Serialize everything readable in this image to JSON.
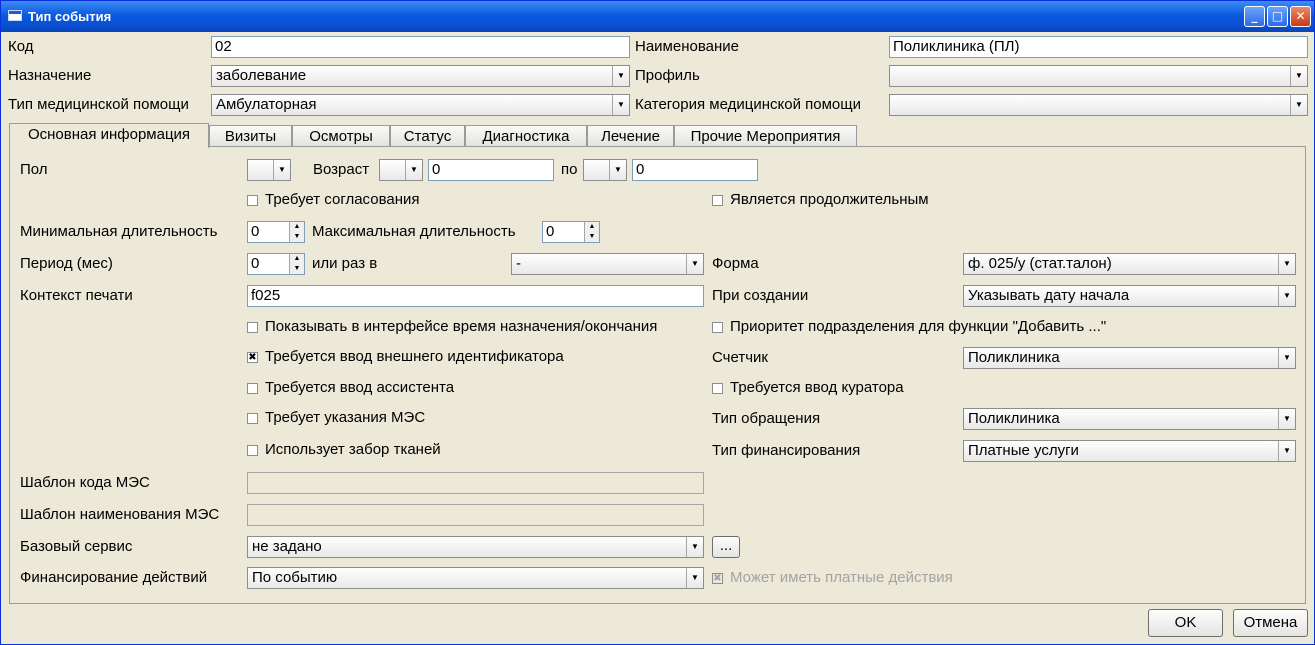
{
  "window": {
    "title": "Тип события"
  },
  "header": {
    "code_label": "Код",
    "code_value": "02",
    "name_label": "Наименование",
    "name_value": "Поликлиника (ПЛ)",
    "purpose_label": "Назначение",
    "purpose_value": "заболевание",
    "profile_label": "Профиль",
    "profile_value": "",
    "care_type_label": "Тип медицинской помощи",
    "care_type_value": "Амбулаторная",
    "care_category_label": "Категория медицинской помощи",
    "care_category_value": ""
  },
  "tabs": [
    {
      "label": "Основная информация"
    },
    {
      "label": "Визиты"
    },
    {
      "label": "Осмотры"
    },
    {
      "label": "Статус"
    },
    {
      "label": "Диагностика"
    },
    {
      "label": "Лечение"
    },
    {
      "label": "Прочие Мероприятия"
    }
  ],
  "main": {
    "sex_label": "Пол",
    "sex_value": "",
    "age_label": "Возраст",
    "age_from_unit": "",
    "age_from": "0",
    "age_to_label": "по",
    "age_to_unit": "",
    "age_to": "0",
    "requires_approval": "Требует согласования",
    "is_long": "Является продолжительным",
    "min_duration_label": "Минимальная длительность",
    "min_duration": "0",
    "max_duration_label": "Максимальная длительность",
    "max_duration": "0",
    "period_label": "Период (мес)",
    "period": "0",
    "times_label": "или раз в",
    "times_value": "-",
    "form_label": "Форма",
    "form_value": "ф. 025/у (стат.талон)",
    "print_context_label": "Контекст печати",
    "print_context": "f025",
    "on_create_label": "При создании",
    "on_create_value": "Указывать дату начала",
    "show_time": "Показывать в интерфейсе время назначения/окончания",
    "dept_priority": "Приоритет подразделения для функции \"Добавить ...\"",
    "ext_id": "Требуется ввод внешнего идентификатора",
    "counter_label": "Счетчик",
    "counter_value": "Поликлиника",
    "assistant": "Требуется ввод ассистента",
    "curator": "Требуется ввод куратора",
    "mes": "Требует указания МЭС",
    "appeal_type_label": "Тип обращения",
    "appeal_type_value": "Поликлиника",
    "tissue": "Использует забор тканей",
    "finance_type_label": "Тип финансирования",
    "finance_type_value": "Платные услуги",
    "mes_code_label": "Шаблон кода МЭС",
    "mes_code": "",
    "mes_name_label": "Шаблон наименования МЭС",
    "mes_name": "",
    "base_service_label": "Базовый сервис",
    "base_service_value": "не задано",
    "ellipsis": "...",
    "actions_finance_label": "Финансирование действий",
    "actions_finance_value": "По событию",
    "paid_actions": "Может иметь платные действия"
  },
  "footer": {
    "ok": "OK",
    "cancel": "Отмена"
  }
}
